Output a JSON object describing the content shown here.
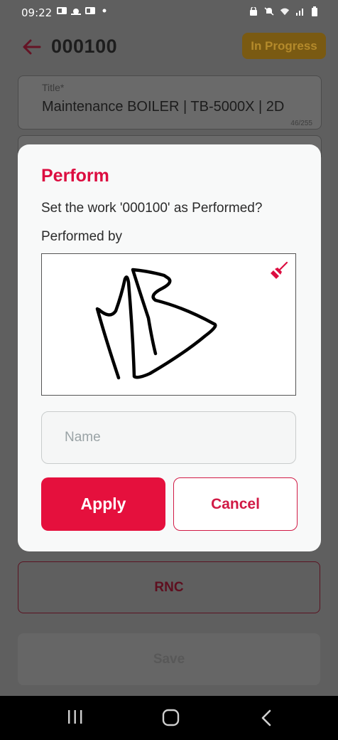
{
  "status_bar": {
    "time": "09:22",
    "icons": [
      "outlook-icon",
      "weather-icon",
      "outlook-icon",
      "dot-icon",
      "lock-icon",
      "mute-icon",
      "wifi-icon",
      "signal-icon",
      "battery-icon"
    ]
  },
  "header": {
    "code": "000100",
    "status": "In Progress",
    "status_color": "#7a5a12"
  },
  "title_field": {
    "label": "Title*",
    "value": "Maintenance BOILER | TB-5000X | 2D",
    "counter": "46/255"
  },
  "dialog": {
    "title": "Perform",
    "message": "Set the work '000100' as Performed?",
    "performed_by_label": "Performed by",
    "name_placeholder": "Name",
    "apply_label": "Apply",
    "cancel_label": "Cancel",
    "accent": "#e5103d"
  },
  "buttons": {
    "rnc_label": "RNC",
    "save_label": "Save"
  },
  "nav": [
    "recents-icon",
    "home-icon",
    "back-nav-icon"
  ]
}
